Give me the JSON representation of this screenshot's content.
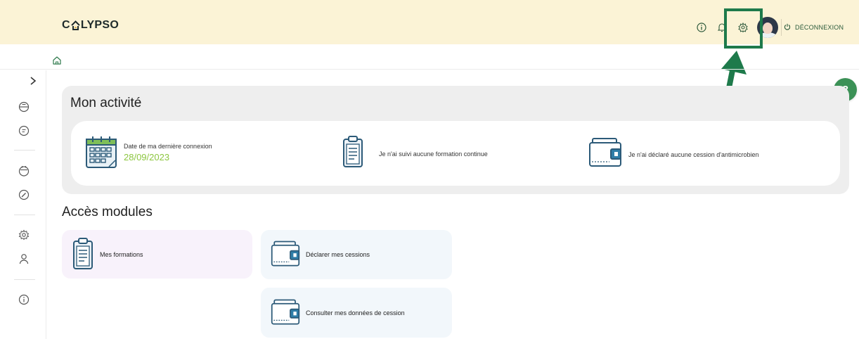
{
  "header": {
    "logo_text_pre": "C",
    "logo_text_post": "LYPSO",
    "logout_label": "DÉCONNEXION"
  },
  "activity": {
    "title": "Mon activité",
    "last_login_label": "Date de ma dernière connexion",
    "last_login_value": "28/09/2023",
    "training_text": "Je n'ai suivi aucune formation continue",
    "cession_text": "Je n'ai déclaré aucune cession d'antimicrobien"
  },
  "modules": {
    "title": "Accès modules",
    "items": [
      {
        "label": "Mes formations"
      },
      {
        "label": "Déclarer mes cessions"
      },
      {
        "label": "Consulter mes données de cession"
      }
    ]
  },
  "help": {
    "label": "?"
  },
  "colors": {
    "header_bg": "#fbf3d6",
    "accent_green": "#1e7a4b",
    "date_green": "#8cc63f",
    "help_green": "#3b9156"
  }
}
